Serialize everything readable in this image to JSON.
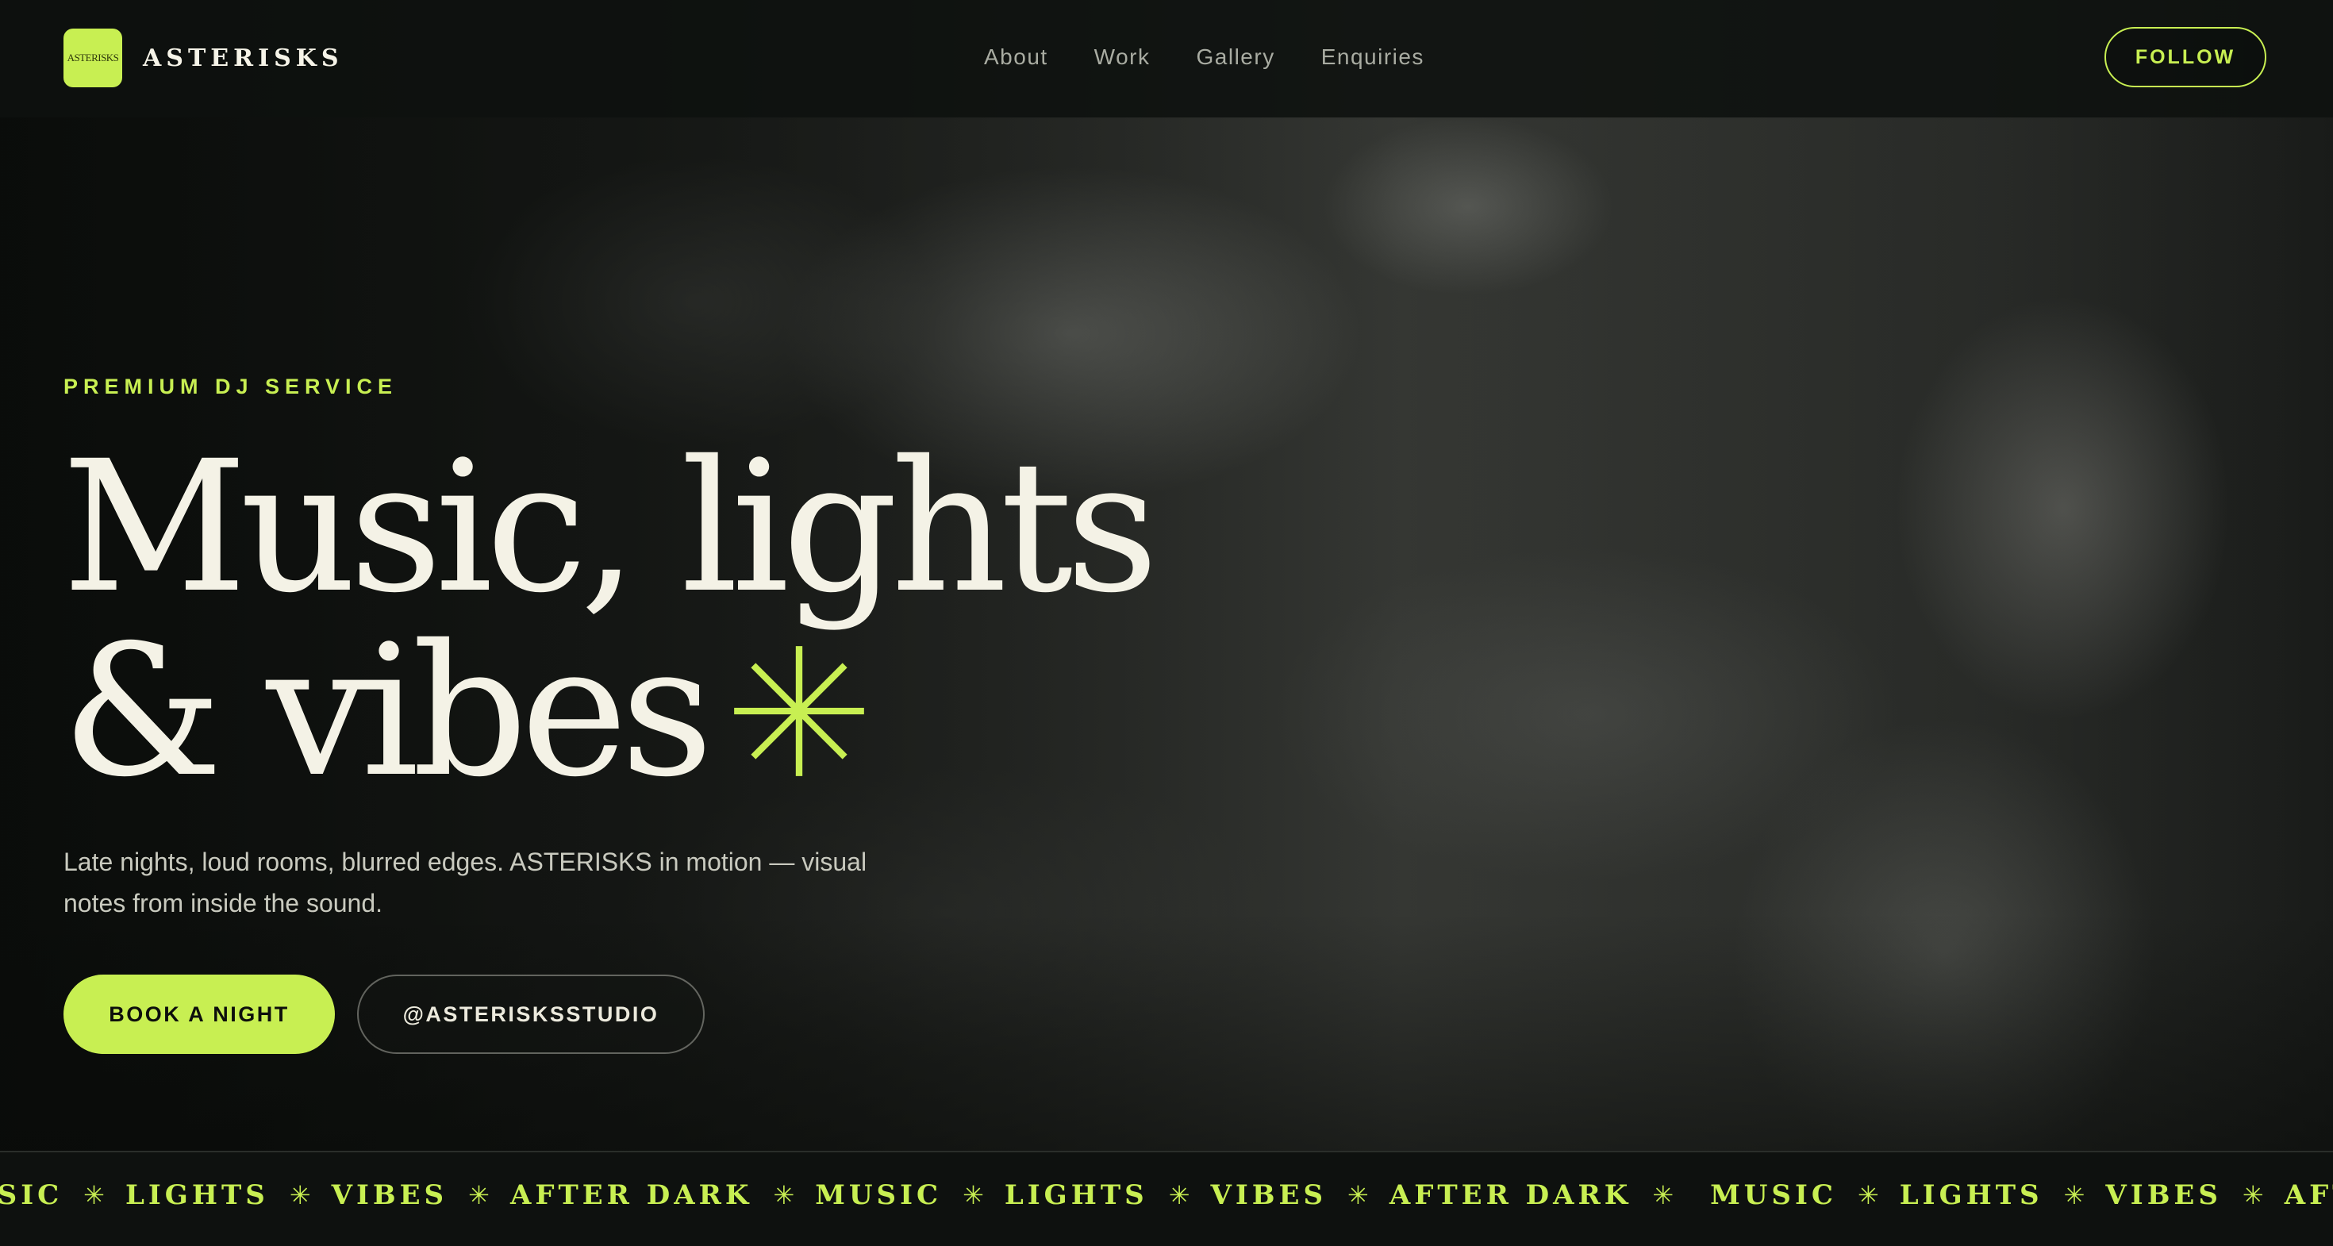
{
  "brand": {
    "logo_text": "ASTERISKS",
    "name": "ASTERISKS"
  },
  "nav": {
    "items": [
      "About",
      "Work",
      "Gallery",
      "Enquiries"
    ]
  },
  "header": {
    "follow_label": "FOLLOW"
  },
  "hero": {
    "eyebrow": "PREMIUM DJ SERVICE",
    "headline_line1": "Music, lights",
    "headline_line2": "& vibes",
    "headline_icon": "asterisk-icon",
    "lede": "Late nights, loud rooms, blurred edges. ASTERISKS in motion — visual notes from inside the sound.",
    "primary_cta": "BOOK A NIGHT",
    "secondary_cta": "@ASTERISKSSTUDIO"
  },
  "ticker": {
    "items": [
      "USIC",
      "LIGHTS",
      "VIBES",
      "AFTER DARK",
      "MUSIC",
      "LIGHTS",
      "VIBES",
      "AFTER DARK",
      "MUSIC",
      "LIGHTS",
      "VIBES",
      "AFTER DA"
    ],
    "separator": "✳"
  },
  "colors": {
    "accent": "#c8ef52",
    "background": "#0b0d0b",
    "text": "#f4f2e6"
  }
}
